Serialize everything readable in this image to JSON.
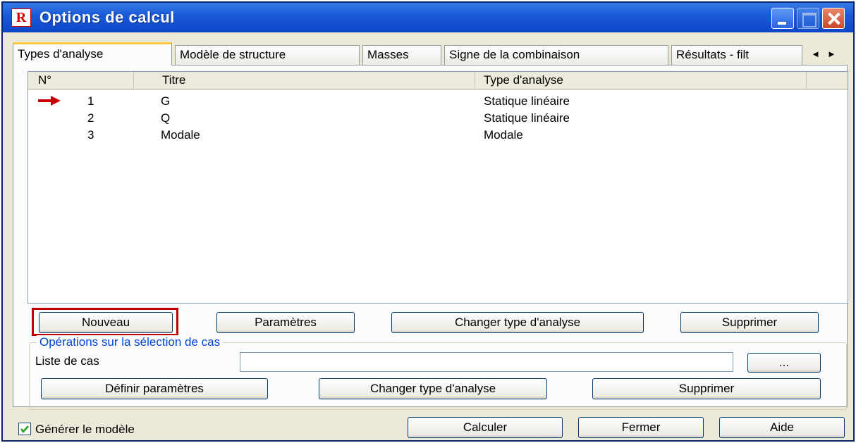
{
  "window": {
    "title": "Options de calcul",
    "app_icon": "R"
  },
  "tabs": [
    {
      "label": "Types d'analyse",
      "active": true
    },
    {
      "label": "Modèle de structure"
    },
    {
      "label": "Masses"
    },
    {
      "label": "Signe de la combinaison"
    },
    {
      "label": "Résultats - filt"
    }
  ],
  "tab_scroll": {
    "left": "◄",
    "right": "►"
  },
  "list": {
    "columns": [
      "N°",
      "Titre",
      "Type d'analyse"
    ],
    "rows": [
      {
        "n": "1",
        "titre": "G",
        "type": "Statique linéaire",
        "current": true
      },
      {
        "n": "2",
        "titre": "Q",
        "type": "Statique linéaire"
      },
      {
        "n": "3",
        "titre": "Modale",
        "type": "Modale"
      }
    ]
  },
  "case_buttons": {
    "new": "Nouveau",
    "params": "Paramètres",
    "change_type": "Changer type d'analyse",
    "delete": "Supprimer"
  },
  "selection_group": {
    "legend": "Opérations sur la sélection de cas",
    "list_label": "Liste de cas",
    "list_value": "",
    "browse": "...",
    "define_params": "Définir paramètres",
    "change_type": "Changer type d'analyse",
    "delete": "Supprimer"
  },
  "footer": {
    "generate_model": "Générer le modèle",
    "generate_checked": true,
    "calculate": "Calculer",
    "close": "Fermer",
    "help": "Aide"
  },
  "colors": {
    "titlebar": "#1a5ad8",
    "highlight": "#c00000",
    "group_legend": "#0046d5",
    "arrow": "#c80000"
  }
}
